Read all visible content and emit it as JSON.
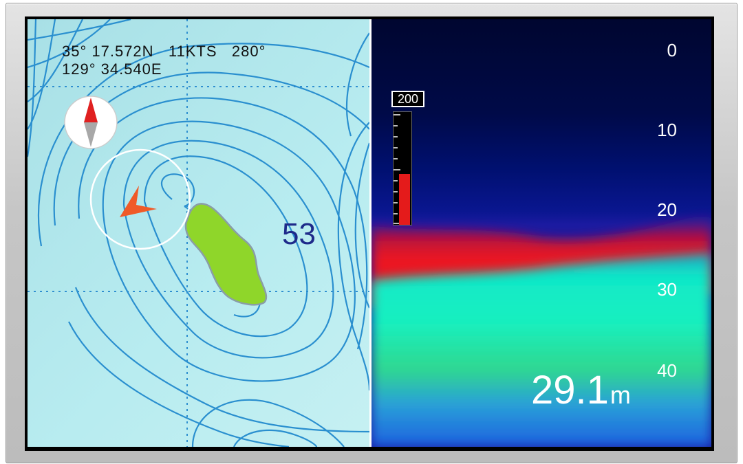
{
  "map": {
    "latitude": "35° 17.572N",
    "speed": "11KTS",
    "heading": "280°",
    "longitude": "129° 34.540E",
    "depth_label": "53",
    "compass_icon": "compass-north-icon",
    "vessel_icon": "vessel-arrow-icon",
    "colors": {
      "water": "#b4e8ee",
      "contour": "#2a8fcf",
      "island": "#8fd62a",
      "vessel": "#f05a28"
    }
  },
  "sonar": {
    "gain_label": "200",
    "gain_level": 0.45,
    "depth_scale": [
      "0",
      "10",
      "20",
      "30",
      "40"
    ],
    "depth_value": "29.1",
    "depth_unit": "m"
  }
}
